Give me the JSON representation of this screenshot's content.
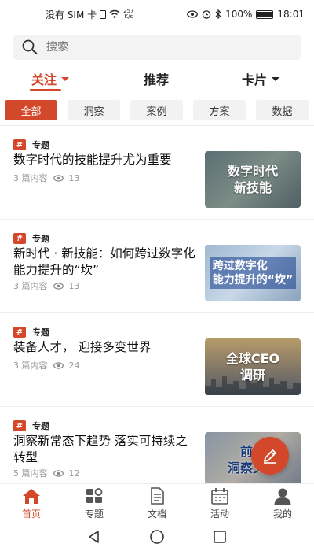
{
  "status": {
    "carrier": "没有 SIM 卡",
    "speed_top": "257",
    "speed_bottom": "K/s",
    "battery": "100%",
    "time": "18:01"
  },
  "search": {
    "placeholder": "搜索"
  },
  "top_tabs": [
    {
      "label": "关注",
      "active": true,
      "has_dropdown": true
    },
    {
      "label": "推荐",
      "active": false,
      "has_dropdown": false
    },
    {
      "label": "卡片",
      "active": false,
      "has_dropdown": true
    }
  ],
  "filters": [
    {
      "label": "全部",
      "active": true
    },
    {
      "label": "洞察",
      "active": false
    },
    {
      "label": "案例",
      "active": false
    },
    {
      "label": "方案",
      "active": false
    },
    {
      "label": "数据",
      "active": false
    }
  ],
  "cards": [
    {
      "tag": "专题",
      "title": "数字时代的技能提升尤为重要",
      "count": "3 篇内容",
      "views": "13",
      "image_text": "数字时代\n新技能"
    },
    {
      "tag": "专题",
      "title": "新时代 · 新技能：如何跨过数字化能力提升的“坎”",
      "count": "3 篇内容",
      "views": "13",
      "image_text": "跨过数字化\n能力提升的“坎”"
    },
    {
      "tag": "专题",
      "title": "装备人才， 迎接多变世界",
      "count": "3 篇内容",
      "views": "24",
      "image_text": "全球CEO\n调研"
    },
    {
      "tag": "专题",
      "title": "洞察新常态下趋势 落实可持续之转型",
      "count": "5 篇内容",
      "views": "12",
      "image_text": "前瞻\n洞察文集"
    }
  ],
  "bottom_tabs": [
    {
      "label": "首页",
      "icon": "home-icon",
      "active": true
    },
    {
      "label": "专题",
      "icon": "topics-icon",
      "active": false
    },
    {
      "label": "文档",
      "icon": "document-icon",
      "active": false
    },
    {
      "label": "活动",
      "icon": "calendar-icon",
      "active": false
    },
    {
      "label": "我的",
      "icon": "profile-icon",
      "active": false
    }
  ],
  "colors": {
    "accent": "#d3482a",
    "chip_bg": "#f2f2f2",
    "meta": "#999999"
  }
}
